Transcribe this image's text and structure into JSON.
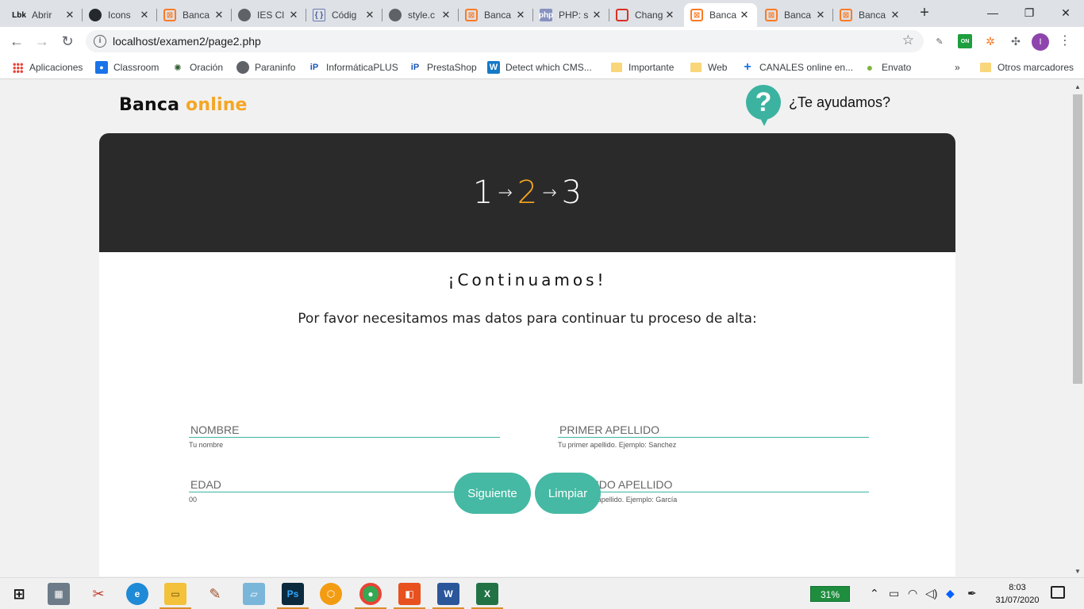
{
  "browser": {
    "tabs": [
      {
        "icon": "lbk-icon",
        "title": "Abrir",
        "active": false
      },
      {
        "icon": "github-icon",
        "title": "Icons",
        "active": false
      },
      {
        "icon": "xampp-icon",
        "title": "Banca",
        "active": false
      },
      {
        "icon": "globe-icon",
        "title": "IES Cl",
        "active": false
      },
      {
        "icon": "code-icon",
        "title": "Códig",
        "active": false
      },
      {
        "icon": "globe-icon",
        "title": "style.c",
        "active": false
      },
      {
        "icon": "xampp-icon",
        "title": "Banca",
        "active": false
      },
      {
        "icon": "php-icon",
        "title": "PHP: s",
        "active": false
      },
      {
        "icon": "change-icon",
        "title": "Chang",
        "active": false
      },
      {
        "icon": "xampp-icon",
        "title": "Banca",
        "active": true
      },
      {
        "icon": "xampp-icon",
        "title": "Banca",
        "active": false
      },
      {
        "icon": "xampp-icon",
        "title": "Banca",
        "active": false
      }
    ],
    "tab_favicon_texts": {
      "lbk": "Lbk",
      "php": "php",
      "code": "{ }"
    },
    "url": "localhost/examen2/page2.php",
    "profile_initial": "I",
    "ext_on_label": "ON",
    "bookmarks": [
      {
        "icon": "apps-icon",
        "label": "Aplicaciones"
      },
      {
        "icon": "classroom-icon",
        "label": "Classroom"
      },
      {
        "icon": "oracion-icon",
        "label": "Oración"
      },
      {
        "icon": "globe-icon",
        "label": "Paraninfo"
      },
      {
        "icon": "informatica-plus-icon",
        "label": "InformáticaPLUS"
      },
      {
        "icon": "prestashop-icon",
        "label": "PrestaShop"
      },
      {
        "icon": "wappalyzer-icon",
        "label": "Detect which CMS..."
      },
      {
        "icon": "folder-icon",
        "label": "Importante"
      },
      {
        "icon": "folder-icon",
        "label": "Web"
      },
      {
        "icon": "plus-icon",
        "label": "CANALES online en..."
      },
      {
        "icon": "envato-icon",
        "label": "Envato"
      }
    ],
    "bookmarks_more": "»",
    "other_bookmarks": "Otros marcadores"
  },
  "page": {
    "logo_part1": "Banca",
    "logo_part2": "online",
    "help_symbol": "?",
    "help_text": "¿Te ayudamos?",
    "steps": {
      "one": "1",
      "two": "2",
      "three": "3",
      "arrow": "→"
    },
    "title": "¡Continuamos!",
    "subtitle": "Por favor necesitamos mas datos para continuar tu proceso de alta:",
    "fields": {
      "nombre": {
        "placeholder": "NOMBRE",
        "hint": "Tu nombre"
      },
      "primer_apellido": {
        "placeholder": "PRIMER APELLIDO",
        "hint": "Tu primer apellido. Ejemplo: Sanchez"
      },
      "edad": {
        "placeholder": "EDAD",
        "hint": "00"
      },
      "segundo_apellido": {
        "placeholder": "SEGUNDO APELLIDO",
        "hint": "Tu segundo apellido. Ejemplo: García"
      }
    },
    "buttons": {
      "next": "Siguiente",
      "clear": "Limpiar"
    }
  },
  "taskbar": {
    "battery": "31%",
    "time": "8:03",
    "date": "31/07/2020",
    "ps_label": "Ps",
    "word_label": "W",
    "excel_label": "X"
  },
  "colors": {
    "accent": "#45b9a3",
    "brand_orange": "#f5a623",
    "header_dark": "#2a2a2a"
  }
}
